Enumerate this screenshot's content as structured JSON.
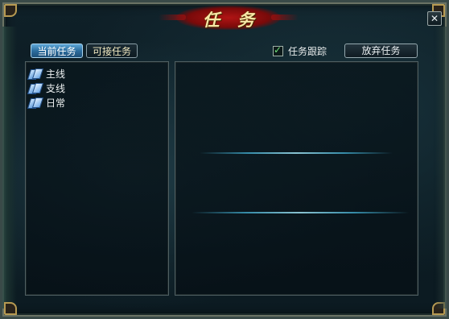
{
  "window": {
    "title": "任务",
    "close_label": "✕"
  },
  "tabs": [
    {
      "label": "当前任务",
      "active": true
    },
    {
      "label": "可接任务",
      "active": false
    }
  ],
  "tracking": {
    "checkbox_mark": "✓",
    "label": "任务跟踪",
    "checked": true
  },
  "actions": {
    "abandon_label": "放弃任务"
  },
  "quest_categories": [
    {
      "label": "主线",
      "icon": "scroll-icon"
    },
    {
      "label": "支线",
      "icon": "scroll-icon"
    },
    {
      "label": "日常",
      "icon": "scroll-icon"
    }
  ],
  "colors": {
    "active_tab": "#2d6e9f",
    "frame_gold": "#b79a52",
    "title_plate": "#b01414",
    "title_text": "#f6e7a6",
    "checkmark": "#6fe27a"
  }
}
